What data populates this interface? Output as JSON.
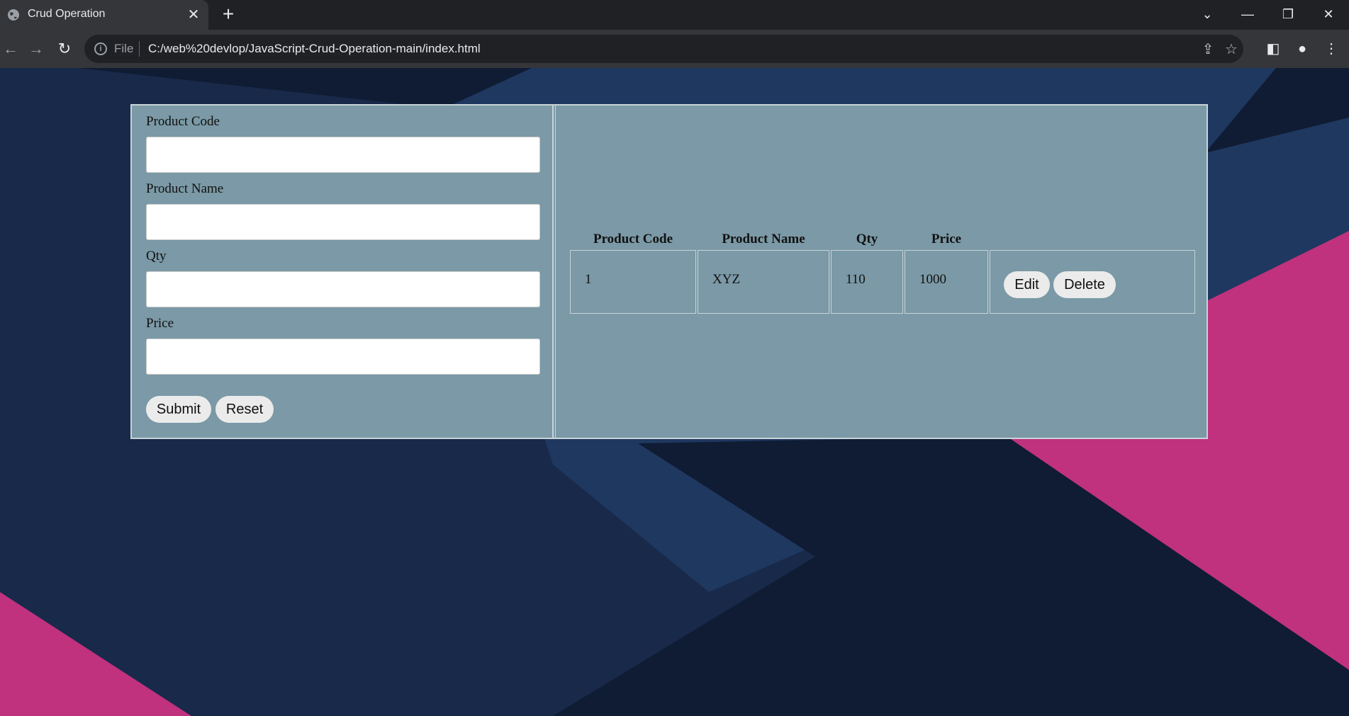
{
  "browser": {
    "tab_title": "Crud Operation",
    "tab_close": "✕",
    "new_tab": "+",
    "scheme_label": "File",
    "url": "C:/web%20devlop/JavaScript-Crud-Operation-main/index.html"
  },
  "form": {
    "fields": [
      {
        "label": "Product Code",
        "value": ""
      },
      {
        "label": "Product Name",
        "value": ""
      },
      {
        "label": "Qty",
        "value": ""
      },
      {
        "label": "Price",
        "value": ""
      }
    ],
    "submit_label": "Submit",
    "reset_label": "Reset"
  },
  "table": {
    "headers": [
      "Product Code",
      "Product Name",
      "Qty",
      "Price"
    ],
    "rows": [
      {
        "code": "1",
        "name": "XYZ",
        "qty": "110",
        "price": "1000",
        "edit_label": "Edit",
        "delete_label": "Delete"
      }
    ]
  },
  "colors": {
    "chrome_dark": "#202124",
    "chrome_tab": "#35363a",
    "page_bg": "#18294a",
    "panel_bg": "#7b99a6",
    "accent_pink": "#c0317e"
  }
}
